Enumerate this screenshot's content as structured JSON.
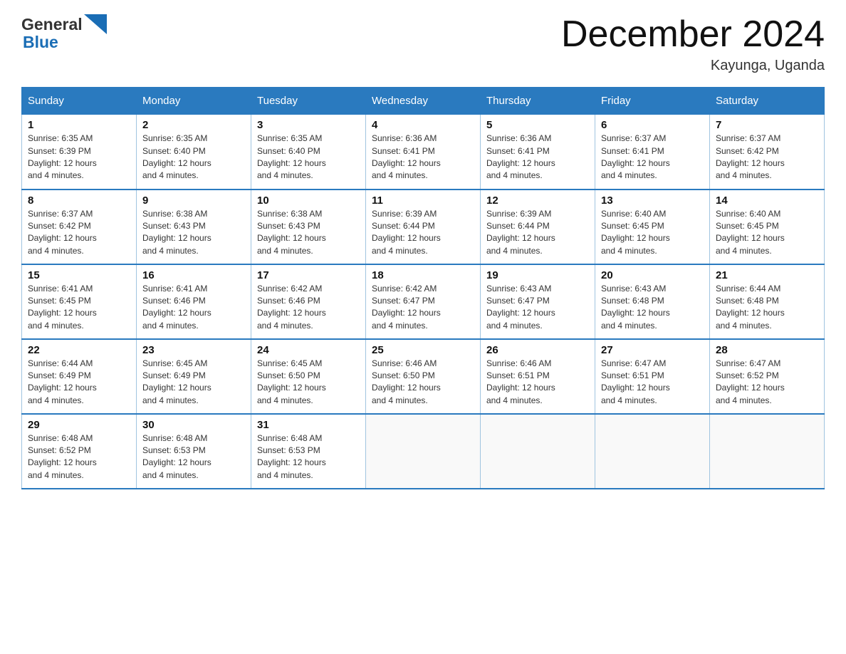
{
  "header": {
    "logo_general": "General",
    "logo_blue": "Blue",
    "month_title": "December 2024",
    "location": "Kayunga, Uganda"
  },
  "days_of_week": [
    "Sunday",
    "Monday",
    "Tuesday",
    "Wednesday",
    "Thursday",
    "Friday",
    "Saturday"
  ],
  "weeks": [
    [
      {
        "num": "1",
        "sunrise": "6:35 AM",
        "sunset": "6:39 PM",
        "daylight": "12 hours and 4 minutes."
      },
      {
        "num": "2",
        "sunrise": "6:35 AM",
        "sunset": "6:40 PM",
        "daylight": "12 hours and 4 minutes."
      },
      {
        "num": "3",
        "sunrise": "6:35 AM",
        "sunset": "6:40 PM",
        "daylight": "12 hours and 4 minutes."
      },
      {
        "num": "4",
        "sunrise": "6:36 AM",
        "sunset": "6:41 PM",
        "daylight": "12 hours and 4 minutes."
      },
      {
        "num": "5",
        "sunrise": "6:36 AM",
        "sunset": "6:41 PM",
        "daylight": "12 hours and 4 minutes."
      },
      {
        "num": "6",
        "sunrise": "6:37 AM",
        "sunset": "6:41 PM",
        "daylight": "12 hours and 4 minutes."
      },
      {
        "num": "7",
        "sunrise": "6:37 AM",
        "sunset": "6:42 PM",
        "daylight": "12 hours and 4 minutes."
      }
    ],
    [
      {
        "num": "8",
        "sunrise": "6:37 AM",
        "sunset": "6:42 PM",
        "daylight": "12 hours and 4 minutes."
      },
      {
        "num": "9",
        "sunrise": "6:38 AM",
        "sunset": "6:43 PM",
        "daylight": "12 hours and 4 minutes."
      },
      {
        "num": "10",
        "sunrise": "6:38 AM",
        "sunset": "6:43 PM",
        "daylight": "12 hours and 4 minutes."
      },
      {
        "num": "11",
        "sunrise": "6:39 AM",
        "sunset": "6:44 PM",
        "daylight": "12 hours and 4 minutes."
      },
      {
        "num": "12",
        "sunrise": "6:39 AM",
        "sunset": "6:44 PM",
        "daylight": "12 hours and 4 minutes."
      },
      {
        "num": "13",
        "sunrise": "6:40 AM",
        "sunset": "6:45 PM",
        "daylight": "12 hours and 4 minutes."
      },
      {
        "num": "14",
        "sunrise": "6:40 AM",
        "sunset": "6:45 PM",
        "daylight": "12 hours and 4 minutes."
      }
    ],
    [
      {
        "num": "15",
        "sunrise": "6:41 AM",
        "sunset": "6:45 PM",
        "daylight": "12 hours and 4 minutes."
      },
      {
        "num": "16",
        "sunrise": "6:41 AM",
        "sunset": "6:46 PM",
        "daylight": "12 hours and 4 minutes."
      },
      {
        "num": "17",
        "sunrise": "6:42 AM",
        "sunset": "6:46 PM",
        "daylight": "12 hours and 4 minutes."
      },
      {
        "num": "18",
        "sunrise": "6:42 AM",
        "sunset": "6:47 PM",
        "daylight": "12 hours and 4 minutes."
      },
      {
        "num": "19",
        "sunrise": "6:43 AM",
        "sunset": "6:47 PM",
        "daylight": "12 hours and 4 minutes."
      },
      {
        "num": "20",
        "sunrise": "6:43 AM",
        "sunset": "6:48 PM",
        "daylight": "12 hours and 4 minutes."
      },
      {
        "num": "21",
        "sunrise": "6:44 AM",
        "sunset": "6:48 PM",
        "daylight": "12 hours and 4 minutes."
      }
    ],
    [
      {
        "num": "22",
        "sunrise": "6:44 AM",
        "sunset": "6:49 PM",
        "daylight": "12 hours and 4 minutes."
      },
      {
        "num": "23",
        "sunrise": "6:45 AM",
        "sunset": "6:49 PM",
        "daylight": "12 hours and 4 minutes."
      },
      {
        "num": "24",
        "sunrise": "6:45 AM",
        "sunset": "6:50 PM",
        "daylight": "12 hours and 4 minutes."
      },
      {
        "num": "25",
        "sunrise": "6:46 AM",
        "sunset": "6:50 PM",
        "daylight": "12 hours and 4 minutes."
      },
      {
        "num": "26",
        "sunrise": "6:46 AM",
        "sunset": "6:51 PM",
        "daylight": "12 hours and 4 minutes."
      },
      {
        "num": "27",
        "sunrise": "6:47 AM",
        "sunset": "6:51 PM",
        "daylight": "12 hours and 4 minutes."
      },
      {
        "num": "28",
        "sunrise": "6:47 AM",
        "sunset": "6:52 PM",
        "daylight": "12 hours and 4 minutes."
      }
    ],
    [
      {
        "num": "29",
        "sunrise": "6:48 AM",
        "sunset": "6:52 PM",
        "daylight": "12 hours and 4 minutes."
      },
      {
        "num": "30",
        "sunrise": "6:48 AM",
        "sunset": "6:53 PM",
        "daylight": "12 hours and 4 minutes."
      },
      {
        "num": "31",
        "sunrise": "6:48 AM",
        "sunset": "6:53 PM",
        "daylight": "12 hours and 4 minutes."
      },
      null,
      null,
      null,
      null
    ]
  ],
  "labels": {
    "sunrise_prefix": "Sunrise: ",
    "sunset_prefix": "Sunset: ",
    "daylight_prefix": "Daylight: "
  }
}
